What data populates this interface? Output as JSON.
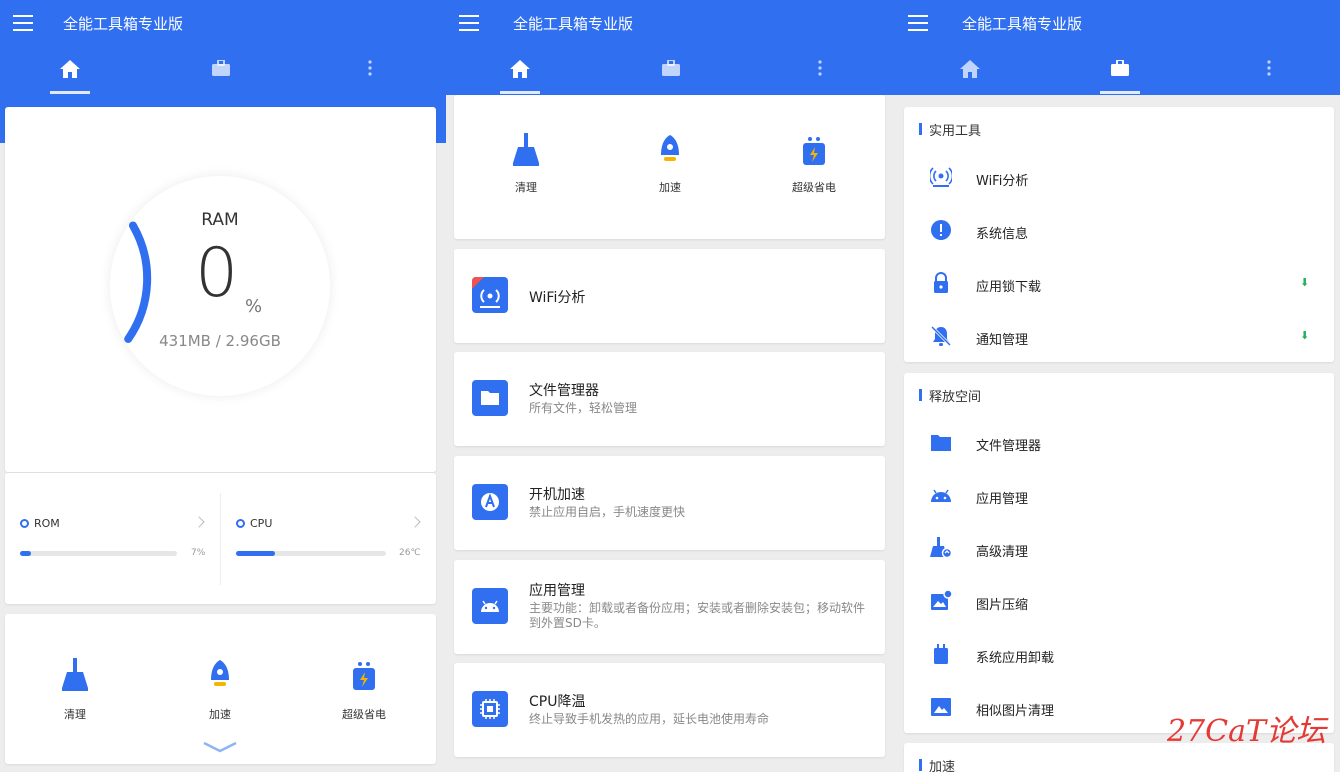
{
  "app": {
    "title": "全能工具箱专业版"
  },
  "screen1": {
    "ram": {
      "title": "RAM",
      "value": "0",
      "unit": "%",
      "detail": "431MB / 2.96GB",
      "arc_fraction": 0.18
    },
    "rom": {
      "label": "ROM",
      "value": "7%",
      "fraction": 0.07
    },
    "cpu": {
      "label": "CPU",
      "value": "26℃",
      "fraction": 0.26
    },
    "actions": [
      "清理",
      "加速",
      "超级省电"
    ]
  },
  "screen2": {
    "actions": [
      "清理",
      "加速",
      "超级省电"
    ],
    "features": [
      {
        "title": "WiFi分析",
        "desc": "",
        "icon": "wifi-icon"
      },
      {
        "title": "文件管理器",
        "desc": "所有文件，轻松管理",
        "icon": "folder-icon"
      },
      {
        "title": "开机加速",
        "desc": "禁止应用自启，手机速度更快",
        "icon": "boot-icon"
      },
      {
        "title": "应用管理",
        "desc": "主要功能：卸载或者备份应用；安装或者删除安装包；移动软件到外置SD卡。",
        "icon": "android-icon"
      },
      {
        "title": "CPU降温",
        "desc": "终止导致手机发热的应用，延长电池使用寿命",
        "icon": "chip-icon"
      }
    ]
  },
  "screen3": {
    "sections": [
      {
        "title": "实用工具",
        "items": [
          {
            "label": "WiFi分析",
            "icon": "wifi-icon",
            "download": false
          },
          {
            "label": "系统信息",
            "icon": "info-icon",
            "download": false
          },
          {
            "label": "应用锁下载",
            "icon": "lock-icon",
            "download": true
          },
          {
            "label": "通知管理",
            "icon": "bell-off-icon",
            "download": true
          }
        ]
      },
      {
        "title": "释放空间",
        "items": [
          {
            "label": "文件管理器",
            "icon": "folder-icon"
          },
          {
            "label": "应用管理",
            "icon": "android-icon"
          },
          {
            "label": "高级清理",
            "icon": "broom-icon"
          },
          {
            "label": "图片压缩",
            "icon": "image-compress-icon"
          },
          {
            "label": "系统应用卸载",
            "icon": "trash-icon"
          },
          {
            "label": "相似图片清理",
            "icon": "image-icon"
          }
        ]
      },
      {
        "title": "加速",
        "items": []
      }
    ],
    "download_glyph": "⬇"
  },
  "watermark": "27CaT论坛",
  "colors": {
    "primary": "#2f6ff0",
    "background": "#ededed",
    "card": "#ffffff"
  }
}
